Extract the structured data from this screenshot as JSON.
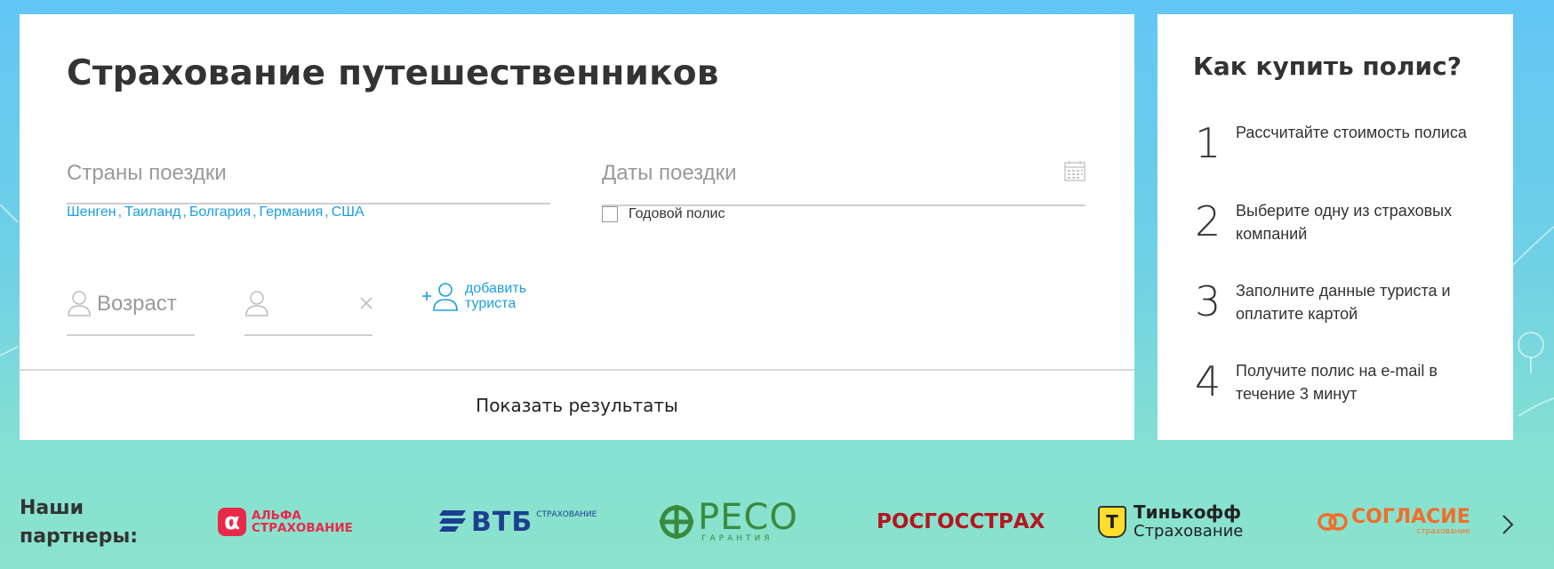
{
  "search_form": {
    "title": "Страхование путешественников",
    "countries_placeholder": "Страны поездки",
    "dates_placeholder": "Даты поездки",
    "popular_countries": [
      "Шенген",
      "Таиланд",
      "Болгария",
      "Германия",
      "США"
    ],
    "popular_separator": ",",
    "annual_policy_label": "Годовой полис",
    "annual_policy_checked": false,
    "age_placeholder": "Возраст",
    "add_tourist_line1": "добавить",
    "add_tourist_line2": "туриста",
    "show_results_label": "Показать результаты"
  },
  "how_to_buy": {
    "title": "Как купить полис?",
    "steps": [
      {
        "number": "1",
        "text": "Рассчитайте стоимость полиса"
      },
      {
        "number": "2",
        "text": "Выберите одну из страховых компаний"
      },
      {
        "number": "3",
        "text": "Заполните данные туриста и оплатите картой"
      },
      {
        "number": "4",
        "text": "Получите полис на e-mail в течение 3 минут"
      }
    ]
  },
  "partners": {
    "title": "Наши партнеры:",
    "logos": {
      "alfa": {
        "mark": "α",
        "line1": "АЛЬФА",
        "line2": "СТРАХОВАНИЕ"
      },
      "vtb": {
        "text": "ВТБ",
        "sub": "СТРАХОВАНИЕ"
      },
      "reso": {
        "text": "РЕСО",
        "sub": "ГАРАНТИЯ"
      },
      "rgs": {
        "text": "РОСГОССТРАХ"
      },
      "tinkoff": {
        "mark": "Т",
        "line1": "Тинькофф",
        "line2": "Страхование"
      },
      "soglasie": {
        "text": "СОГЛАСИЕ",
        "sub": "страхование"
      }
    }
  },
  "colors": {
    "link_blue": "#1a9fe3",
    "alfa_red": "#e8294a",
    "vtb_blue": "#1d3f8f",
    "reso_green": "#3a8a3e",
    "rgs_red": "#b4161f",
    "tinkoff_yellow": "#ffdd2d",
    "soglasie_orange": "#f26d28"
  }
}
